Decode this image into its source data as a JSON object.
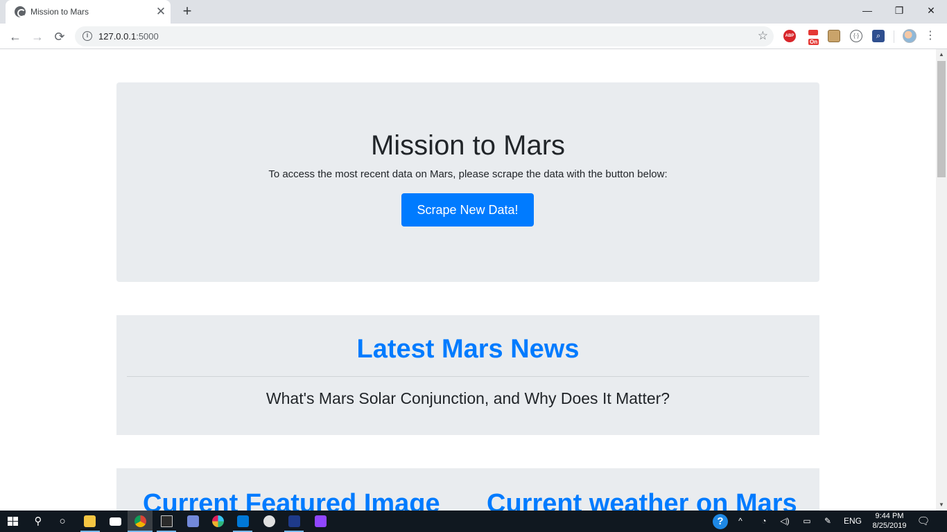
{
  "browser": {
    "tab_title": "Mission to Mars",
    "tab_close": "✕",
    "new_tab": "+",
    "window_controls": {
      "minimize": "—",
      "restore": "❐",
      "close": "✕"
    },
    "nav": {
      "back": "←",
      "forward": "→",
      "reload": "⟳"
    },
    "url_host": "127.0.0.1",
    "url_port": ":5000",
    "star_icon": "☆",
    "extensions": {
      "abp_label": "ABP",
      "on_label": "On",
      "code_label": "{·}",
      "search_label": "⌕"
    },
    "menu": "⋮"
  },
  "page": {
    "jumbotron": {
      "title": "Mission to Mars",
      "lead": "To access the most recent data on Mars, please scrape the data with the button below:",
      "button_label": "Scrape New Data!"
    },
    "news": {
      "heading": "Latest Mars News",
      "title": "What's Mars Solar Conjunction, and Why Does It Matter?"
    },
    "lower": {
      "left_heading": "Current Featured Image",
      "right_heading": "Current weather on Mars"
    }
  },
  "scrollbar": {
    "up": "▲",
    "down": "▼"
  },
  "taskbar": {
    "search_icon": "⚲",
    "cortana_icon": "○",
    "help_label": "?",
    "tray_chevron": "^",
    "language": "ENG",
    "time": "9:44 PM",
    "date": "8/25/2019",
    "notification_icon": "🗨"
  },
  "colors": {
    "primary": "#007bff",
    "jumbotron_bg": "#e9ecef",
    "text_dark": "#212529",
    "taskbar_bg": "#101820"
  }
}
